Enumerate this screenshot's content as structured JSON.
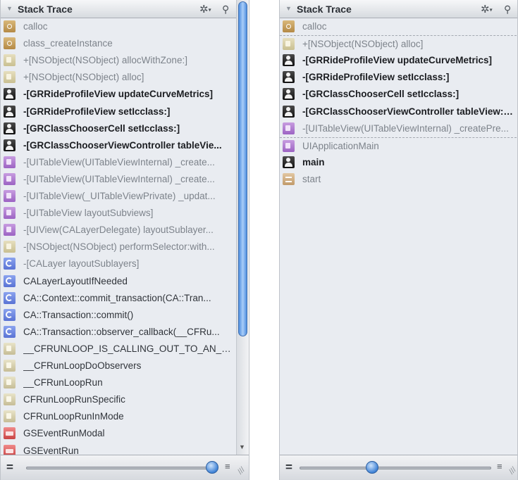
{
  "left_panel": {
    "title": "Stack Trace",
    "rows": [
      {
        "icon": "lib",
        "label": "calloc",
        "style": "dim"
      },
      {
        "icon": "lib",
        "label": "class_createInstance",
        "style": "dim"
      },
      {
        "icon": "foundation",
        "label": "+[NSObject(NSObject) allocWithZone:]",
        "style": "dim"
      },
      {
        "icon": "foundation",
        "label": "+[NSObject(NSObject) alloc]",
        "style": "dim"
      },
      {
        "icon": "user",
        "label": "-[GRRideProfileView updateCurveMetrics]",
        "style": "bold"
      },
      {
        "icon": "user",
        "label": "-[GRRideProfileView setIcclass:]",
        "style": "bold"
      },
      {
        "icon": "user",
        "label": "-[GRClassChooserCell setIcclass:]",
        "style": "bold"
      },
      {
        "icon": "user",
        "label": "-[GRClassChooserViewController tableVie...",
        "style": "bold"
      },
      {
        "icon": "uikit",
        "label": "-[UITableView(UITableViewInternal) _create...",
        "style": "dim"
      },
      {
        "icon": "uikit",
        "label": "-[UITableView(UITableViewInternal) _create...",
        "style": "dim"
      },
      {
        "icon": "uikit",
        "label": "-[UITableView(_UITableViewPrivate) _updat...",
        "style": "dim"
      },
      {
        "icon": "uikit",
        "label": "-[UITableView layoutSubviews]",
        "style": "dim"
      },
      {
        "icon": "uikit",
        "label": "-[UIView(CALayerDelegate) layoutSublayer...",
        "style": "dim"
      },
      {
        "icon": "foundation",
        "label": "-[NSObject(NSObject) performSelector:with...",
        "style": "dim"
      },
      {
        "icon": "qc",
        "label": "-[CALayer layoutSublayers]",
        "style": "dim"
      },
      {
        "icon": "qc",
        "label": "CALayerLayoutIfNeeded",
        "style": "normal"
      },
      {
        "icon": "qc",
        "label": "CA::Context::commit_transaction(CA::Tran...",
        "style": "normal"
      },
      {
        "icon": "qc",
        "label": "CA::Transaction::commit()",
        "style": "normal"
      },
      {
        "icon": "qc",
        "label": "CA::Transaction::observer_callback(__CFRu...",
        "style": "normal"
      },
      {
        "icon": "cf",
        "label": "__CFRUNLOOP_IS_CALLING_OUT_TO_AN_O...",
        "style": "normal"
      },
      {
        "icon": "cf",
        "label": "__CFRunLoopDoObservers",
        "style": "normal"
      },
      {
        "icon": "cf",
        "label": "__CFRunLoopRun",
        "style": "normal"
      },
      {
        "icon": "cf",
        "label": "CFRunLoopRunSpecific",
        "style": "normal"
      },
      {
        "icon": "cf",
        "label": "CFRunLoopRunInMode",
        "style": "normal"
      },
      {
        "icon": "gs",
        "label": "GSEventRunModal",
        "style": "normal"
      },
      {
        "icon": "gs",
        "label": "GSEventRun",
        "style": "normal"
      }
    ]
  },
  "right_panel": {
    "title": "Stack Trace",
    "rows": [
      {
        "icon": "lib",
        "label": "calloc",
        "style": "dim",
        "separator_above": false
      },
      {
        "icon": "foundation",
        "label": "+[NSObject(NSObject) alloc]",
        "style": "dim",
        "separator_above": true
      },
      {
        "icon": "user",
        "label": "-[GRRideProfileView updateCurveMetrics]",
        "style": "bold",
        "separator_above": false
      },
      {
        "icon": "user",
        "label": "-[GRRideProfileView setIcclass:]",
        "style": "bold",
        "separator_above": false
      },
      {
        "icon": "user",
        "label": "-[GRClassChooserCell setIcclass:]",
        "style": "bold",
        "separator_above": false
      },
      {
        "icon": "user",
        "label": "-[GRClassChooserViewController tableView:ce...",
        "style": "bold",
        "separator_above": false
      },
      {
        "icon": "uikit",
        "label": "-[UITableView(UITableViewInternal) _createPre...",
        "style": "dim",
        "separator_above": false
      },
      {
        "icon": "uikit",
        "label": "UIApplicationMain",
        "style": "dim",
        "separator_above": true
      },
      {
        "icon": "user",
        "label": "main",
        "style": "bold",
        "separator_above": false
      },
      {
        "icon": "start",
        "label": "start",
        "style": "dim",
        "separator_above": false
      }
    ]
  },
  "controls": {
    "left_slider_value": 1.0,
    "right_slider_value": 0.38
  },
  "colors": {
    "panel_bg": "#e9ecf1",
    "scroll_thumb": "#4f8fe0",
    "slider_knob": "#3f82d6"
  }
}
